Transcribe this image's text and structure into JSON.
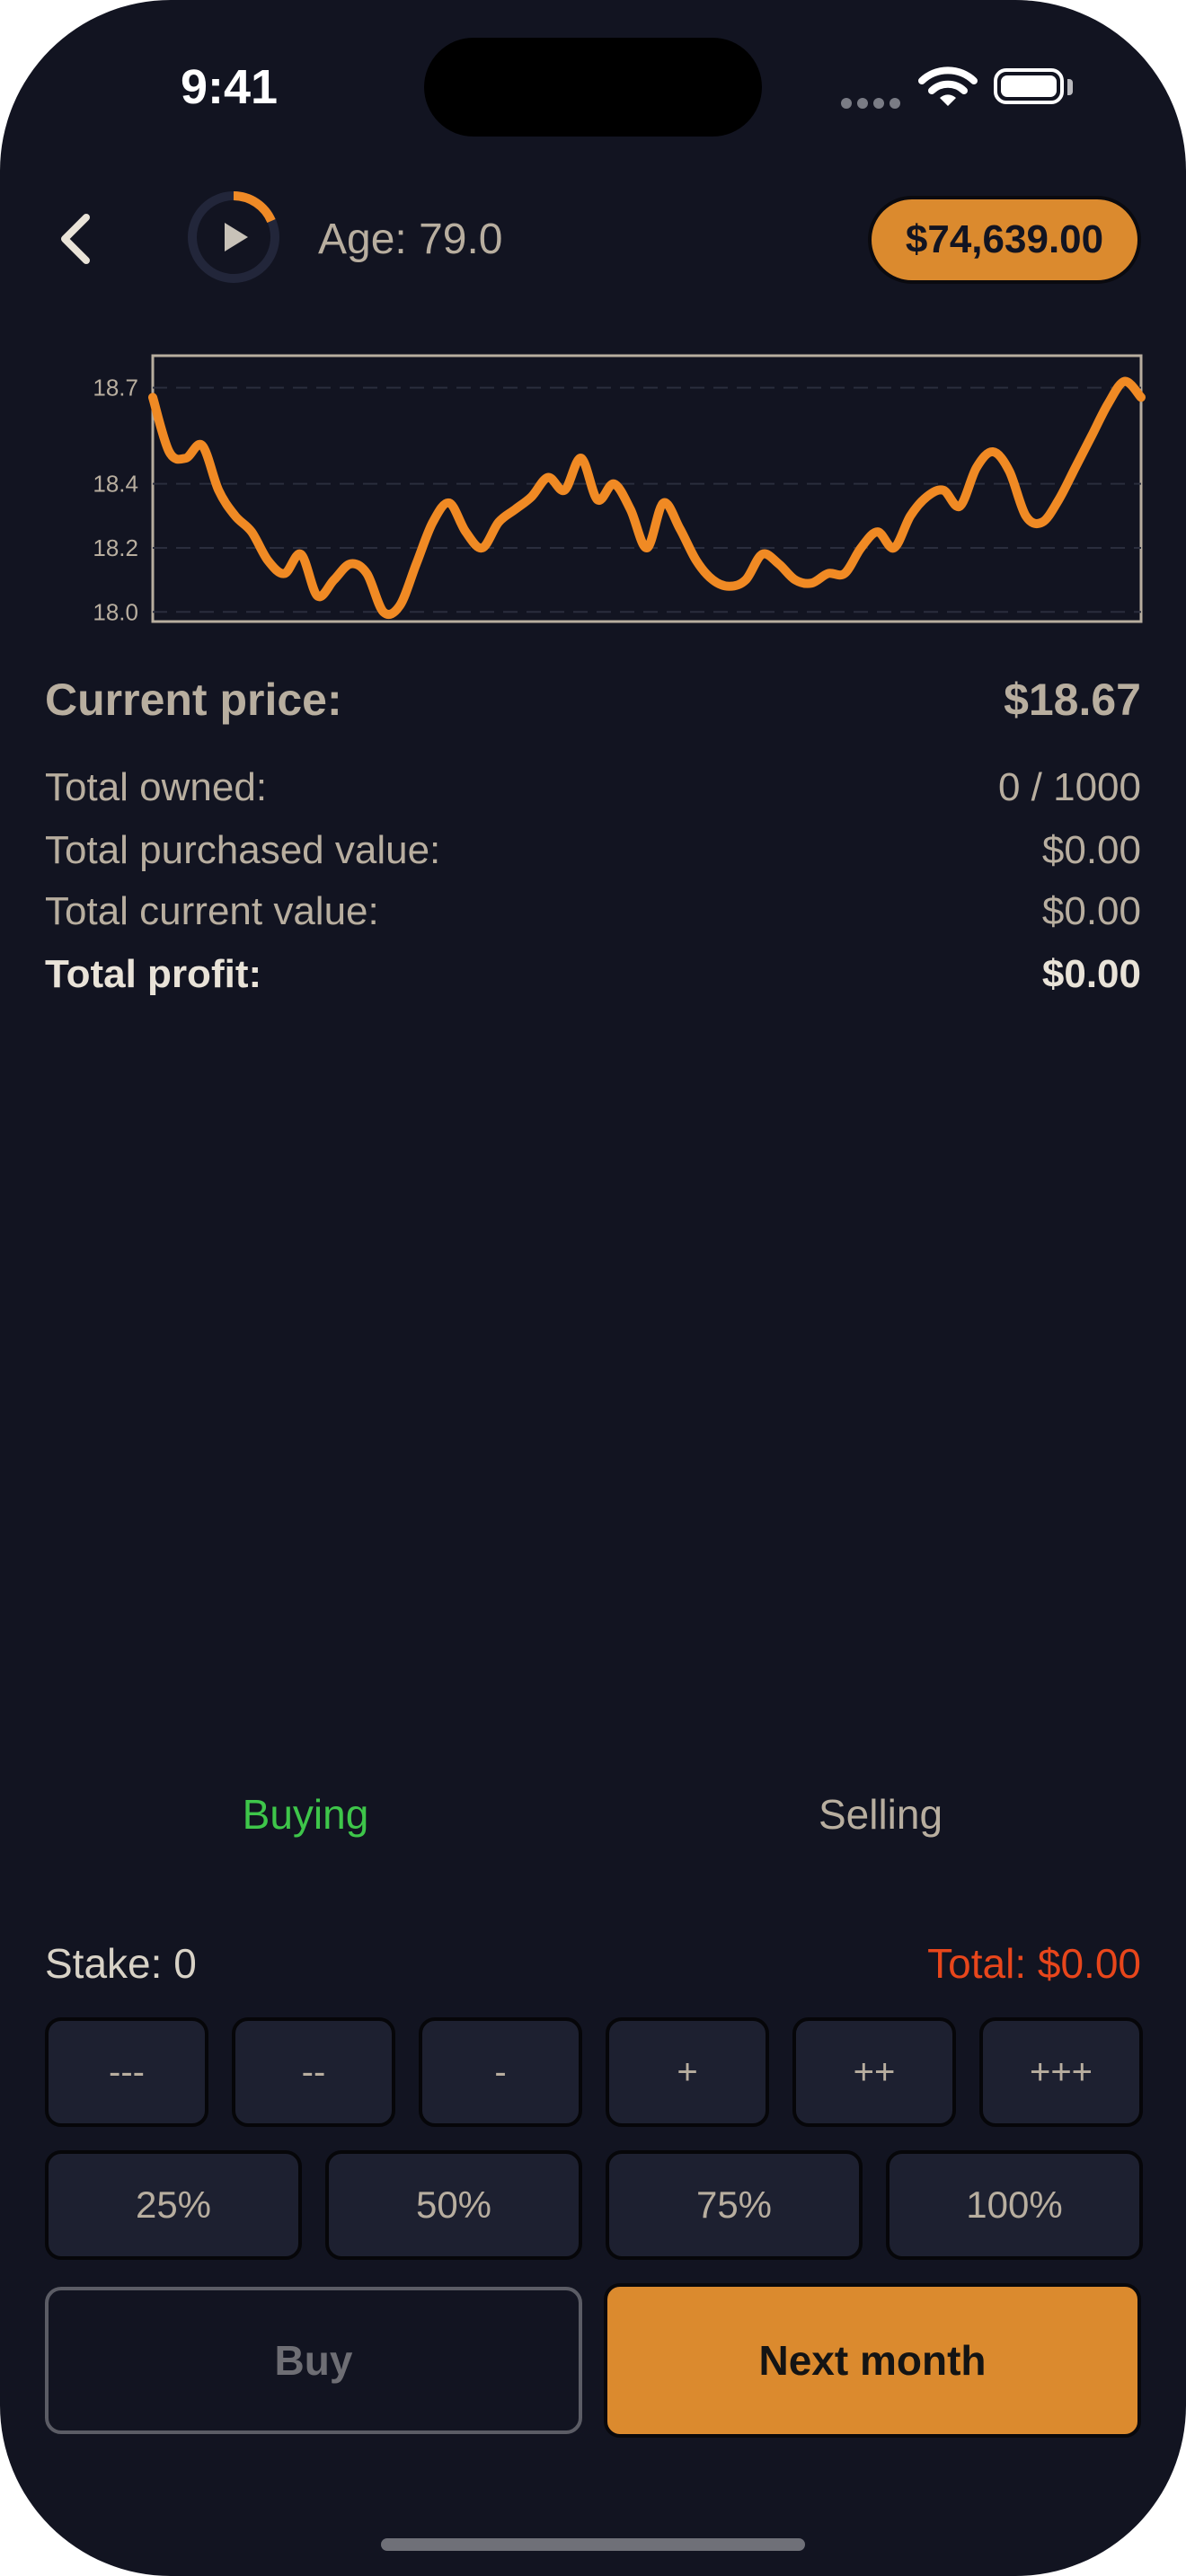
{
  "status": {
    "time": "9:41"
  },
  "header": {
    "age_label": "Age: 79.0",
    "balance": "$74,639.00"
  },
  "chart_data": {
    "type": "line",
    "yticks": [
      "18.7",
      "18.4",
      "18.2",
      "18.0"
    ],
    "ylim": [
      17.97,
      18.8
    ],
    "grid": true,
    "series": [
      {
        "color": "#f08a24",
        "values": [
          18.67,
          18.5,
          18.48,
          18.52,
          18.38,
          18.3,
          18.25,
          18.16,
          18.12,
          18.18,
          18.05,
          18.1,
          18.15,
          18.12,
          18.0,
          18.02,
          18.15,
          18.28,
          18.34,
          18.25,
          18.2,
          18.28,
          18.32,
          18.36,
          18.42,
          18.38,
          18.48,
          18.35,
          18.4,
          18.32,
          18.2,
          18.34,
          18.26,
          18.16,
          18.1,
          18.08,
          18.1,
          18.18,
          18.15,
          18.1,
          18.09,
          18.12,
          18.12,
          18.2,
          18.25,
          18.2,
          18.3,
          18.36,
          18.38,
          18.33,
          18.45,
          18.5,
          18.44,
          18.3,
          18.28,
          18.35,
          18.45,
          18.55,
          18.65,
          18.72,
          18.67
        ]
      }
    ]
  },
  "stats": {
    "price_label": "Current price:",
    "price_value": "$18.67",
    "owned_label": "Total owned:",
    "owned_value": "0 / 1000",
    "purchased_label": "Total purchased value:",
    "purchased_value": "$0.00",
    "current_label": "Total current value:",
    "current_value": "$0.00",
    "profit_label": "Total profit:",
    "profit_value": "$0.00"
  },
  "tabs": {
    "buying": "Buying",
    "selling": "Selling"
  },
  "trade": {
    "stake_label": "Stake: 0",
    "total_label": "Total: $0.00",
    "steps": [
      "---",
      "--",
      "-",
      "+",
      "++",
      "+++"
    ],
    "percents": [
      "25%",
      "50%",
      "75%",
      "100%"
    ],
    "buy_label": "Buy",
    "next_label": "Next month"
  },
  "colors": {
    "accent": "#db8a2e",
    "background": "#121421",
    "buying": "#3ec64a",
    "total": "#e8461b"
  }
}
